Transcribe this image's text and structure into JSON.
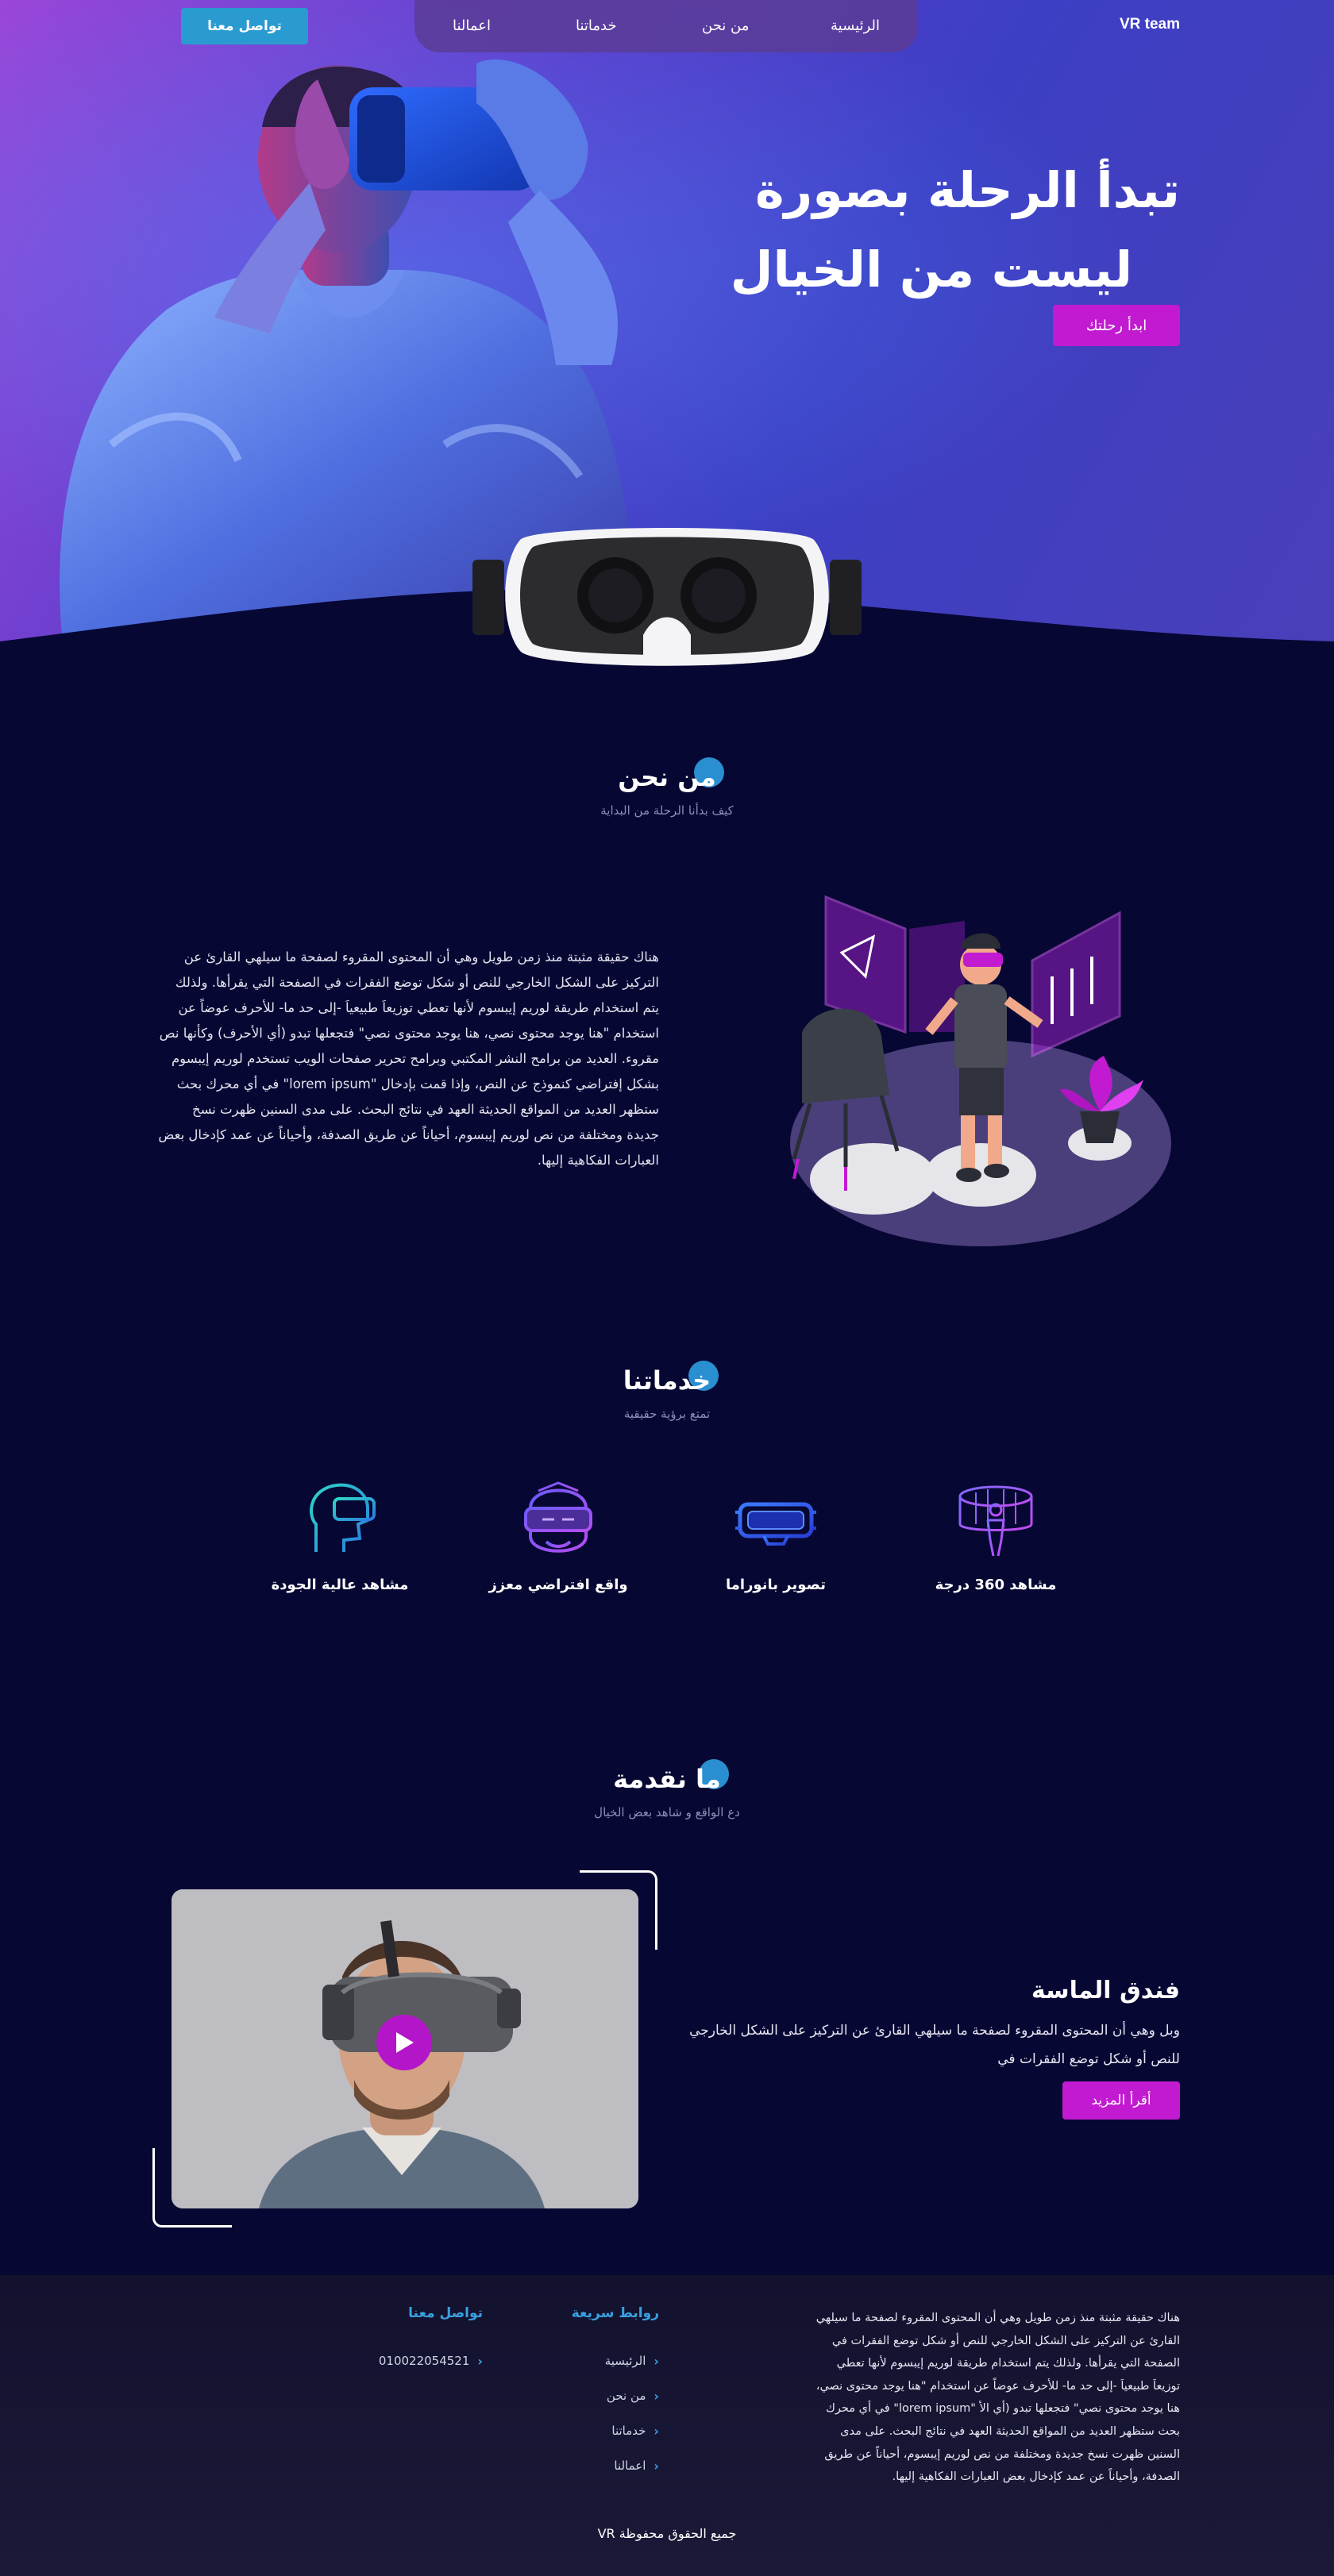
{
  "header": {
    "brand": "VR team",
    "nav": [
      "الرئيسية",
      "من نحن",
      "خدماتنا",
      "اعمالنا"
    ],
    "contact_button": "تواصل معنا"
  },
  "hero": {
    "title_line1": "تبدأ الرحلة بصورة",
    "title_line2": "ليست من الخيال",
    "cta": "ابدأ رحلتك"
  },
  "about": {
    "title": "من نحن",
    "subtitle": "كيف بدأنا الرحلة من البداية",
    "body": "هناك حقيقة مثبتة منذ زمن طويل وهي أن المحتوى المقروء لصفحة ما سيلهي القارئ عن التركيز على الشكل الخارجي للنص أو شكل توضع الفقرات في الصفحة التي يقرأها. ولذلك يتم استخدام طريقة لوريم إيبسوم لأنها تعطي توزيعاَ طبيعياَ -إلى حد ما- للأحرف عوضاً عن استخدام \"هنا يوجد محتوى نصي، هنا يوجد محتوى نصي\" فتجعلها تبدو (أي الأحرف) وكأنها نص مقروء. العديد من برامح النشر المكتبي وبرامح تحرير صفحات الويب تستخدم لوريم إيبسوم بشكل إفتراضي كنموذج عن النص، وإذا قمت بإدخال \"lorem ipsum\" في أي محرك بحث ستظهر العديد من المواقع الحديثة العهد في نتائج البحث. على مدى السنين ظهرت نسخ جديدة ومختلفة من نص لوريم إيبسوم، أحياناً عن طريق الصدفة، وأحياناً عن عمد كإدخال بعض العبارات الفكاهية إليها."
  },
  "services": {
    "title": "خدماتنا",
    "subtitle": "تمتع برؤية حقيقية",
    "items": [
      {
        "label": "مشاهد 360 درجة",
        "icon": "vr-360-person-icon"
      },
      {
        "label": "تصوير بانوراما",
        "icon": "vr-goggles-icon"
      },
      {
        "label": "واقع افتراضي معزز",
        "icon": "vr-headset-face-icon"
      },
      {
        "label": "مشاهد عالية الجودة",
        "icon": "head-profile-vr-icon"
      }
    ]
  },
  "offer": {
    "title": "ما نقدمة",
    "subtitle": "دع الواقع و شاهد بعض الخيال",
    "card_title": "فندق الماسة",
    "card_text": "وبل وهي أن المحتوى المقروء لصفحة ما سيلهي القارئ عن التركيز على الشكل الخارجي للنص أو شكل توضع الفقرات في",
    "more_button": "أقرأ المزيد"
  },
  "footer": {
    "about": "هناك حقيقة مثبتة منذ زمن طويل وهي أن المحتوى المقروء لصفحة ما سيلهي القارئ عن التركيز على الشكل الخارجي للنص أو شكل توضع الفقرات في الصفحة التي يقرأها. ولذلك يتم استخدام طريقة لوريم إيبسوم لأنها تعطي توزيعاَ طبيعياَ -إلى حد ما- للأحرف عوضاً عن استخدام \"هنا يوجد محتوى نصي، هنا يوجد محتوى نصي\" فتجعلها تبدو (أي الأ \"lorem ipsum\" في أي محرك بحث ستظهر العديد من المواقع الحديثة العهد في نتائج البحث. على مدى السنين ظهرت نسخ جديدة ومختلفة من نص لوريم إيبسوم، أحياناً عن طريق الصدفة، وأحياناً عن عمد كإدخال بعض العبارات الفكاهية إليها.",
    "quick_links_title": "روابط سريعة",
    "quick_links": [
      "الرئيسية",
      "من نحن",
      "خدماتنا",
      "اعمالنا"
    ],
    "contact_title": "تواصل معنا",
    "phone": "010022054521",
    "copyright": "جميع الحقوق محفوظة VR"
  },
  "colors": {
    "background": "#070733",
    "accent_magenta": "#c21ad1",
    "accent_blue": "#2a9bd1"
  }
}
